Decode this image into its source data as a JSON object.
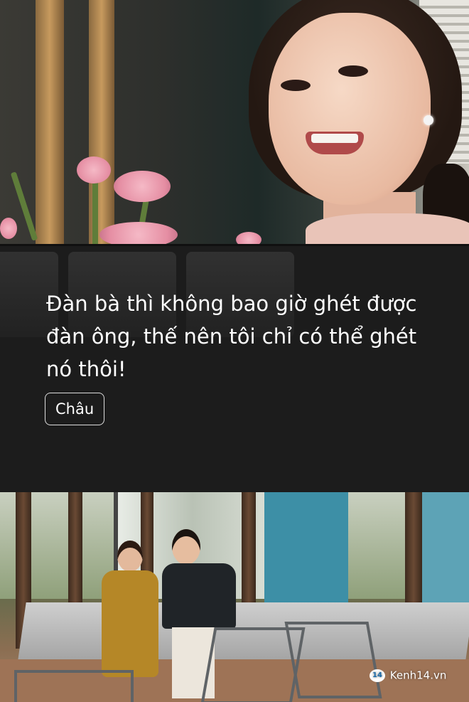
{
  "quote": {
    "text": "Đàn bà thì không bao giờ ghét được đàn ông, thế nên tôi chỉ có thể ghét nó thôi!",
    "speaker": "Châu"
  },
  "watermark": {
    "badge": "14",
    "site": "Kenh14.vn"
  }
}
